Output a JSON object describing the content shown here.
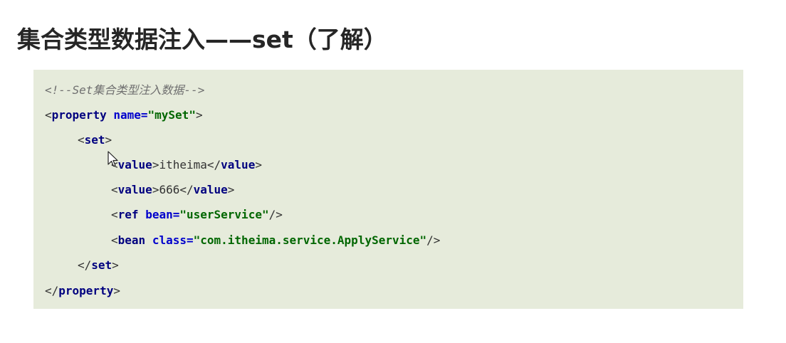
{
  "title": "集合类型数据注入——set（了解）",
  "code": {
    "comment": "<!--Set集合类型注入数据-->",
    "open_bracket": "<",
    "close_bracket": ">",
    "end_open": "</",
    "self_close": "/>",
    "eq": "=",
    "property_tag": "property",
    "name_attr": "name",
    "name_value": "\"mySet\"",
    "set_tag": "set",
    "value_tag": "value",
    "value_1": "itheima",
    "value_2": "666",
    "ref_tag": "ref",
    "bean_attr": "bean",
    "bean_value": "\"userService\"",
    "bean_tag": "bean",
    "class_attr": "class",
    "class_value": "\"com.itheima.service.ApplyService\""
  },
  "cursor_icon": "mouse-pointer-icon"
}
